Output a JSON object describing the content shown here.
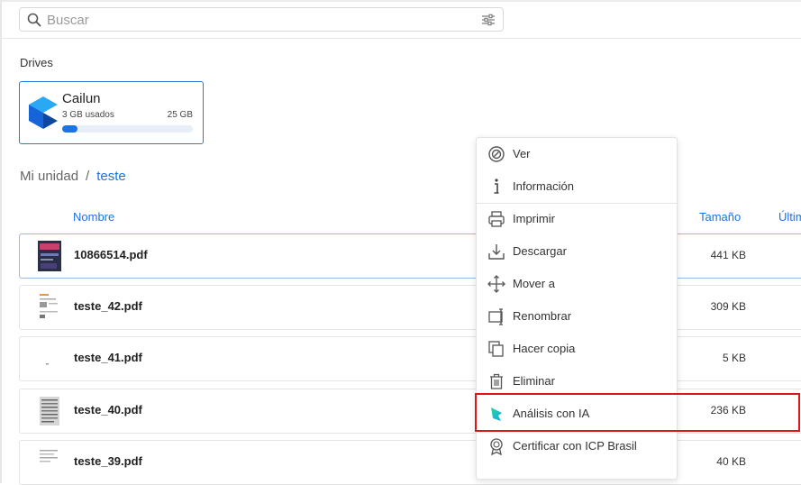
{
  "search": {
    "placeholder": "Buscar"
  },
  "drives": {
    "label": "Drives",
    "items": [
      {
        "name": "Cailun",
        "used": "3 GB usados",
        "total": "25 GB",
        "usage_fraction": 0.12
      }
    ]
  },
  "breadcrumb": {
    "root": "Mi unidad",
    "separator": "/",
    "current": "teste"
  },
  "table": {
    "columns": {
      "name": "Nombre",
      "size": "Tamaño",
      "last": "Últim"
    },
    "rows": [
      {
        "name": "10866514.pdf",
        "size": "441 KB"
      },
      {
        "name": "teste_42.pdf",
        "size": "309 KB"
      },
      {
        "name": "teste_41.pdf",
        "size": "5 KB"
      },
      {
        "name": "teste_40.pdf",
        "size": "236 KB"
      },
      {
        "name": "teste_39.pdf",
        "size": "40 KB"
      }
    ]
  },
  "context_menu": {
    "items": [
      {
        "label": "Ver",
        "icon": "eye-circle-icon"
      },
      {
        "label": "Información",
        "icon": "info-icon"
      },
      {
        "label": "Imprimir",
        "icon": "printer-icon"
      },
      {
        "label": "Descargar",
        "icon": "download-icon"
      },
      {
        "label": "Mover a",
        "icon": "move-icon"
      },
      {
        "label": "Renombrar",
        "icon": "rename-icon"
      },
      {
        "label": "Hacer copia",
        "icon": "copy-icon"
      },
      {
        "label": "Eliminar",
        "icon": "trash-icon"
      },
      {
        "label": "Análisis con IA",
        "icon": "ai-analysis-icon"
      },
      {
        "label": "Certificar con ICP Brasil",
        "icon": "certificate-icon"
      }
    ]
  },
  "colors": {
    "accent": "#1a73e8",
    "highlight": "#e01515"
  }
}
